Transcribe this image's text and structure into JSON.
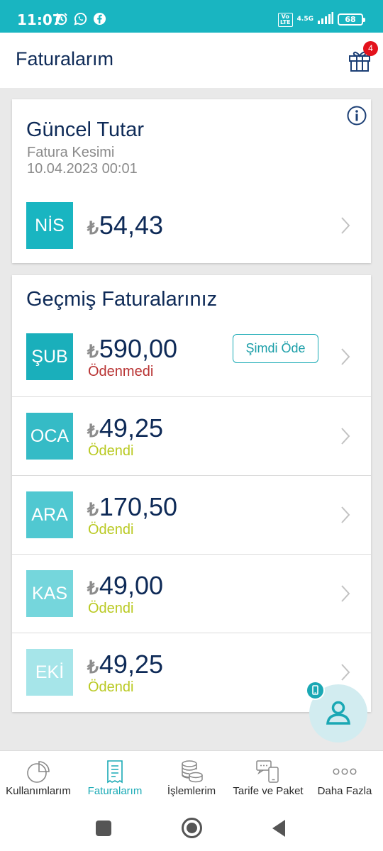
{
  "status_bar": {
    "time": "11:07",
    "volte": "Vo\nLTE",
    "network": "4.5G",
    "battery": "68",
    "left_icons": [
      "alarm-icon",
      "whatsapp-icon",
      "facebook-icon"
    ]
  },
  "header": {
    "title": "Faturalarım",
    "gift_badge": "4"
  },
  "current": {
    "title": "Güncel Tutar",
    "cut_label": "Fatura Kesimi",
    "cut_date": "10.04.2023 00:01",
    "month": "NİS",
    "currency": "₺",
    "amount": "54,43"
  },
  "history": {
    "title": "Geçmiş Faturalarınız",
    "pay_label": "Şimdi Öde",
    "bills": [
      {
        "month": "ŞUB",
        "currency": "₺",
        "amount": "590,00",
        "status": "Ödenmedi",
        "status_color": "#b83232",
        "box_color": "#1aafbb"
      },
      {
        "month": "OCA",
        "currency": "₺",
        "amount": "49,25",
        "status": "Ödendi",
        "status_color": "#b9c921",
        "box_color": "#35bbc6"
      },
      {
        "month": "ARA",
        "currency": "₺",
        "amount": "170,50",
        "status": "Ödendi",
        "status_color": "#b9c921",
        "box_color": "#50c8d1"
      },
      {
        "month": "KAS",
        "currency": "₺",
        "amount": "49,00",
        "status": "Ödendi",
        "status_color": "#b9c921",
        "box_color": "#75d6dc"
      },
      {
        "month": "EKİ",
        "currency": "₺",
        "amount": "49,25",
        "status": "Ödendi",
        "status_color": "#b9c921",
        "box_color": "#a6e5e9"
      }
    ]
  },
  "bottom_nav": [
    {
      "label": "Kullanımlarım",
      "icon": "pie-chart-icon",
      "active": false
    },
    {
      "label": "Faturalarım",
      "icon": "receipt-icon",
      "active": true
    },
    {
      "label": "İşlemlerim",
      "icon": "coins-icon",
      "active": false
    },
    {
      "label": "Tarife ve Paket",
      "icon": "phone-chat-icon",
      "active": false
    },
    {
      "label": "Daha Fazla",
      "icon": "more-dots-icon",
      "active": false
    }
  ],
  "colors": {
    "brand": "#19b5c1",
    "title_text": "#0e2a57",
    "unpaid": "#b83232",
    "paid": "#b9c921",
    "badge": "#e3121c"
  }
}
